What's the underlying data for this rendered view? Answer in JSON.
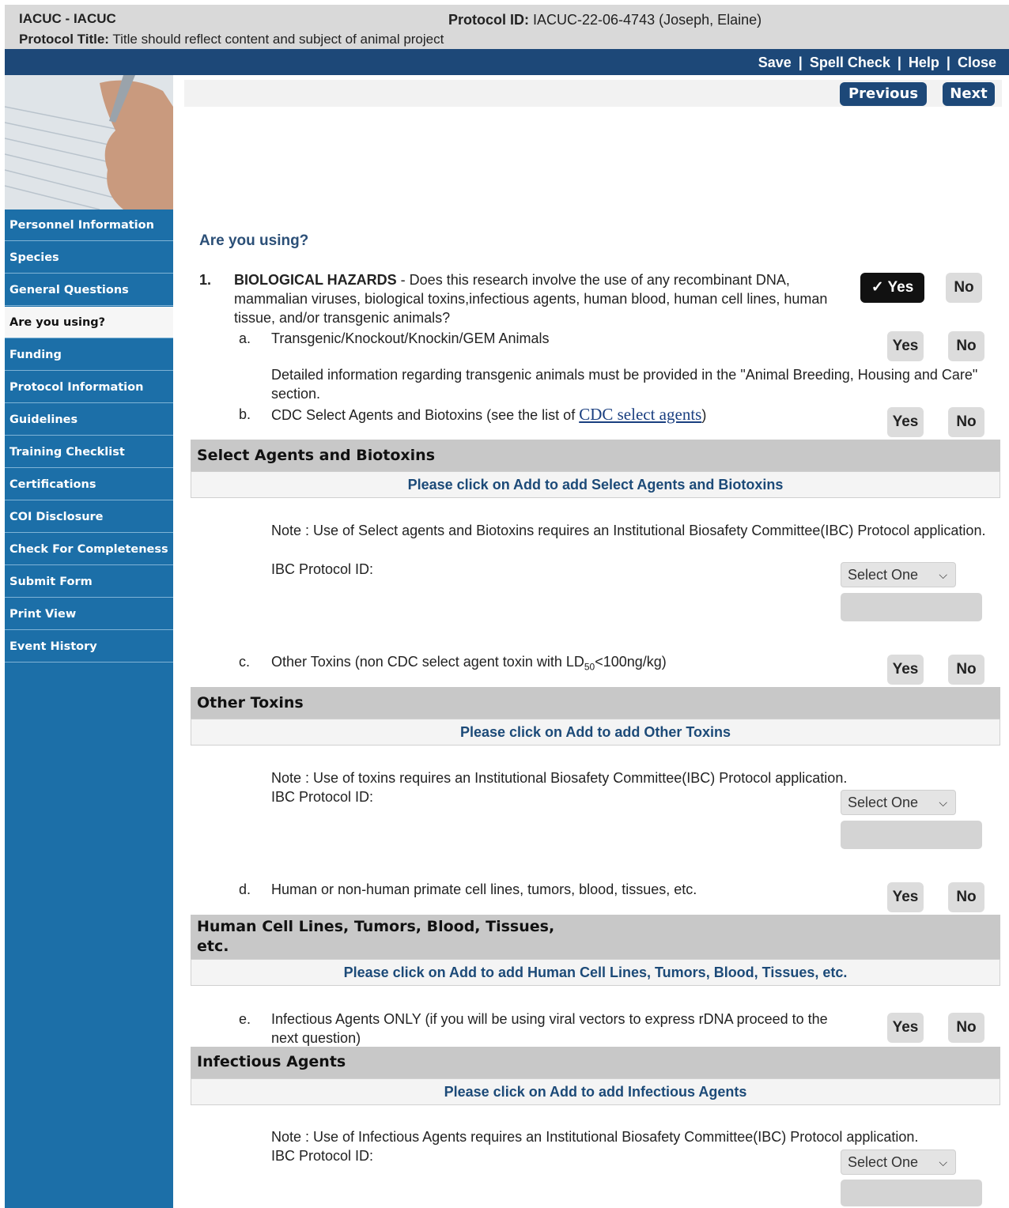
{
  "header": {
    "app_title": "IACUC - IACUC",
    "protocol_id_label": "Protocol ID:",
    "protocol_id_value": "IACUC-22-06-4743 (Joseph, Elaine)",
    "protocol_title_label": "Protocol Title:",
    "protocol_title_value": "Title should reflect content and subject of animal project"
  },
  "toplinks": {
    "save": "Save",
    "spell_check": "Spell Check",
    "help": "Help",
    "close": "Close",
    "separator": "|"
  },
  "toolbar": {
    "previous": "Previous",
    "next": "Next"
  },
  "sidebar": {
    "items": [
      {
        "label": "Personnel Information"
      },
      {
        "label": "Species"
      },
      {
        "label": "General Questions"
      },
      {
        "label": "Are you using?"
      },
      {
        "label": "Funding"
      },
      {
        "label": "Protocol Information"
      },
      {
        "label": "Guidelines"
      },
      {
        "label": "Training Checklist"
      },
      {
        "label": "Certifications"
      },
      {
        "label": "COI Disclosure"
      },
      {
        "label": "Check For Completeness"
      },
      {
        "label": "Submit Form"
      },
      {
        "label": "Print View"
      },
      {
        "label": "Event History"
      }
    ]
  },
  "main": {
    "heading": "Are you using?",
    "q1": {
      "number": "1.",
      "title": "BIOLOGICAL HAZARDS",
      "text": " - Does this research involve the use of any recombinant DNA, mammalian viruses, biological toxins,infectious agents, human blood, human cell lines, human tissue, and/or transgenic animals?",
      "yes": "Yes",
      "no": "No",
      "yes_checkmark": "✓"
    },
    "a": {
      "letter": "a.",
      "text": "Transgenic/Knockout/Knockin/GEM Animals",
      "detail": "Detailed information regarding transgenic animals must be provided in the \"Animal Breeding, Housing and Care\" section.",
      "yes": "Yes",
      "no": "No"
    },
    "b": {
      "letter": "b.",
      "text": "CDC Select Agents and Biotoxins (see the list of ",
      "link": "CDC select agents",
      "text_end": ")",
      "yes": "Yes",
      "no": "No",
      "section_title": "Select Agents and Biotoxins",
      "add_text": "Please click on Add to add Select Agents and Biotoxins",
      "note": "Note : Use of Select agents and Biotoxins requires an Institutional Biosafety Committee(IBC) Protocol application.",
      "ibc_label": "IBC Protocol ID:",
      "select": "Select One"
    },
    "c": {
      "letter": "c.",
      "text_start": "Other Toxins (non CDC select agent toxin with LD",
      "sub": "50",
      "text_end": "<100ng/kg)",
      "yes": "Yes",
      "no": "No",
      "section_title": "Other Toxins",
      "add_text": "Please click on Add to add Other Toxins",
      "note": "Note : Use of toxins requires an Institutional Biosafety Committee(IBC) Protocol application.",
      "ibc_label": "IBC Protocol ID:",
      "select": "Select One"
    },
    "d": {
      "letter": "d.",
      "text": "Human or non-human primate cell lines, tumors, blood, tissues, etc.",
      "yes": "Yes",
      "no": "No",
      "section_title_line1": "Human Cell Lines, Tumors, Blood, Tissues,",
      "section_title_line2": "etc.",
      "add_text": "Please click on Add to add Human Cell Lines, Tumors, Blood, Tissues, etc."
    },
    "e": {
      "letter": "e.",
      "text": "Infectious Agents ONLY (if you will be using viral vectors to express rDNA proceed to the next question)",
      "yes": "Yes",
      "no": "No",
      "section_title": "Infectious Agents",
      "add_text": "Please click on Add to add Infectious Agents",
      "note": "Note : Use of Infectious Agents requires an Institutional Biosafety Committee(IBC) Protocol application.",
      "ibc_label": "IBC Protocol ID:",
      "select": "Select One"
    }
  },
  "icons": {
    "dropdown": "chevron-down-icon",
    "check": "checkmark-icon"
  },
  "colors": {
    "nav_blue": "#1d4878",
    "sidebar_blue": "#1c6fa8",
    "link_blue": "#1c4a78"
  }
}
